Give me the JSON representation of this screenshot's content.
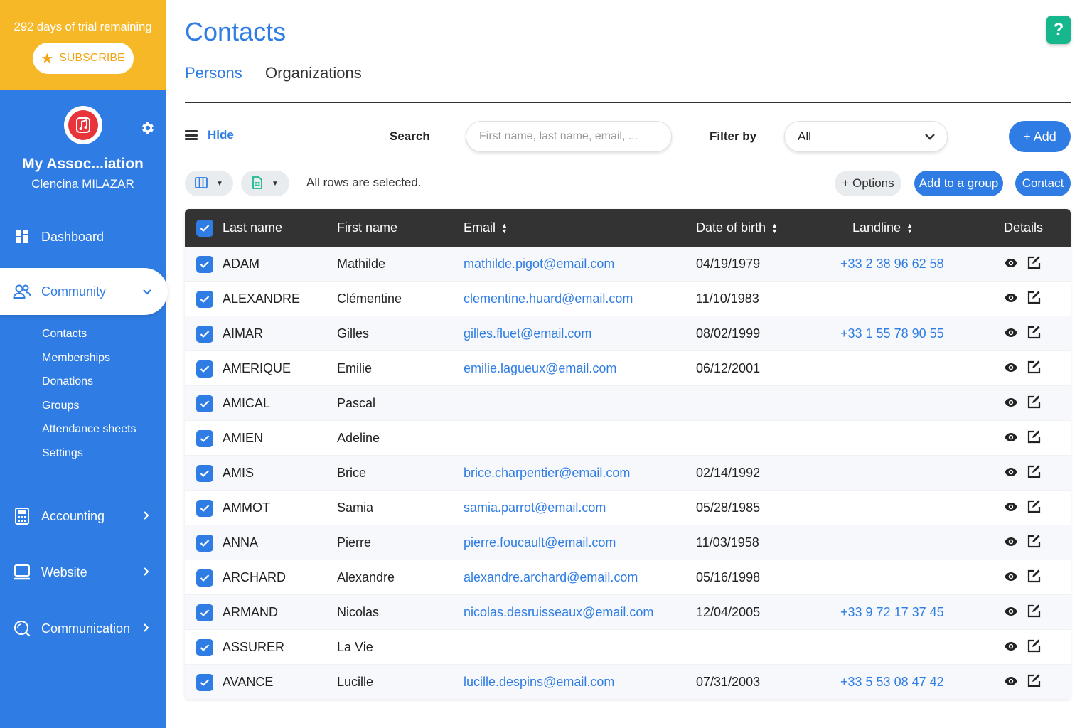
{
  "sidebar": {
    "trial_text": "292 days of trial remaining",
    "subscribe_label": "SUBSCRIBE",
    "assoc_name": "My Assoc...iation",
    "user_name": "Clencina MILAZAR",
    "nav": {
      "dashboard": "Dashboard",
      "community": "Community",
      "accounting": "Accounting",
      "website": "Website",
      "communication": "Communication"
    },
    "subnav": [
      "Contacts",
      "Memberships",
      "Donations",
      "Groups",
      "Attendance sheets",
      "Settings"
    ]
  },
  "page": {
    "title": "Contacts",
    "tabs": [
      "Persons",
      "Organizations"
    ],
    "help": "?"
  },
  "toolbar": {
    "hide_label": "Hide",
    "search_label": "Search",
    "search_placeholder": "First name, last name, email, ...",
    "filter_label": "Filter by",
    "filter_value": "All",
    "add_label": "+ Add",
    "selection_text": "All rows are selected.",
    "options_label": "+ Options",
    "add_group_label": "Add to a group",
    "contact_label": "Contact"
  },
  "table": {
    "headers": {
      "last": "Last name",
      "first": "First name",
      "email": "Email",
      "dob": "Date of birth",
      "landline": "Landline",
      "details": "Details"
    },
    "rows": [
      {
        "last": "ADAM",
        "first": "Mathilde",
        "email": "mathilde.pigot@email.com",
        "dob": "04/19/1979",
        "landline": "+33 2 38 96 62 58"
      },
      {
        "last": "ALEXANDRE",
        "first": "Clémentine",
        "email": "clementine.huard@email.com",
        "dob": "11/10/1983",
        "landline": ""
      },
      {
        "last": "AIMAR",
        "first": "Gilles",
        "email": "gilles.fluet@email.com",
        "dob": "08/02/1999",
        "landline": "+33 1 55 78 90 55"
      },
      {
        "last": "AMERIQUE",
        "first": "Emilie",
        "email": "emilie.lagueux@email.com",
        "dob": "06/12/2001",
        "landline": ""
      },
      {
        "last": "AMICAL",
        "first": "Pascal",
        "email": "",
        "dob": "",
        "landline": ""
      },
      {
        "last": "AMIEN",
        "first": "Adeline",
        "email": "",
        "dob": "",
        "landline": ""
      },
      {
        "last": "AMIS",
        "first": "Brice",
        "email": "brice.charpentier@email.com",
        "dob": "02/14/1992",
        "landline": ""
      },
      {
        "last": "AMMOT",
        "first": "Samia",
        "email": "samia.parrot@email.com",
        "dob": "05/28/1985",
        "landline": ""
      },
      {
        "last": "ANNA",
        "first": "Pierre",
        "email": "pierre.foucault@email.com",
        "dob": "11/03/1958",
        "landline": ""
      },
      {
        "last": "ARCHARD",
        "first": "Alexandre",
        "email": "alexandre.archard@email.com",
        "dob": "05/16/1998",
        "landline": ""
      },
      {
        "last": "ARMAND",
        "first": "Nicolas",
        "email": "nicolas.desruisseaux@email.com",
        "dob": "12/04/2005",
        "landline": "+33 9 72 17 37 45"
      },
      {
        "last": "ASSURER",
        "first": "La Vie",
        "email": "",
        "dob": "",
        "landline": ""
      },
      {
        "last": "AVANCE",
        "first": "Lucille",
        "email": "lucille.despins@email.com",
        "dob": "07/31/2003",
        "landline": "+33 5 53 08 47 42"
      }
    ]
  },
  "colors": {
    "primary": "#2f7de4",
    "trial_banner": "#f7b827",
    "help_button": "#17b78d",
    "table_header": "#333333"
  }
}
